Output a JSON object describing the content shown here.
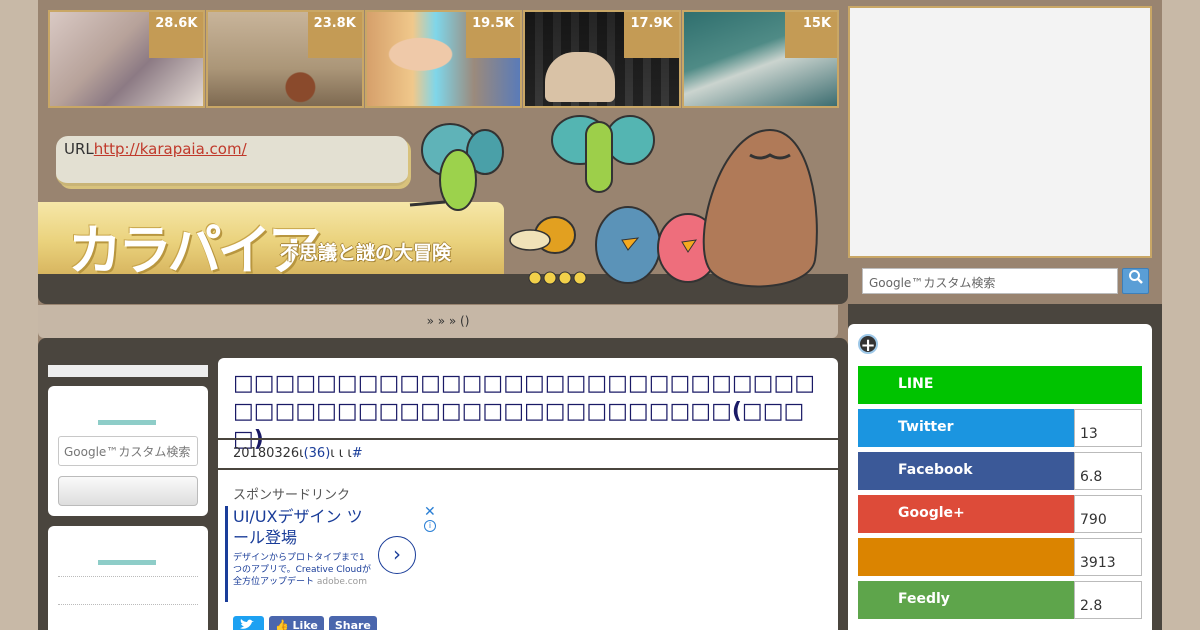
{
  "trending": [
    {
      "count": "28.6K"
    },
    {
      "count": "23.8K"
    },
    {
      "count": "19.5K"
    },
    {
      "count": "17.9K"
    },
    {
      "count": "15K"
    }
  ],
  "header": {
    "url_prefix": "URL",
    "url": "http://karapaia.com/",
    "logo": "カラパイア",
    "tagline": "不思議と謎の大冒険"
  },
  "breadcrumb": "»  »     » ()",
  "sidebar_left": {
    "search_placeholder": "Google™カスタム検索"
  },
  "article": {
    "title": "□□□□□□□□□□□□□□□□□□□□□□□□□□□□□□□□□□□□□□□□□□□□□□□□□□□□(□□□□)",
    "date": "20180326",
    "sep1": "ι",
    "comment_count": "(36)",
    "sep2": "ι ι     ι",
    "hash": "#",
    "sponsor": "スポンサードリンク"
  },
  "ad": {
    "headline": "UI/UXデザイン ツール登場",
    "body": "デザインからプロトタイプまで1つのアプリで。Creative Cloudが全方位アップデート",
    "domain": "adobe.com",
    "arrow": "›",
    "close": "✕",
    "info": "i"
  },
  "article_share": [
    {
      "label": ""
    },
    {
      "label": "Like"
    },
    {
      "label": "Share"
    }
  ],
  "right": {
    "search_placeholder": "Google™カスタム検索",
    "search_icon": "magnifier-icon",
    "plus": "+"
  },
  "share_counts": [
    {
      "name": "LINE",
      "count": "",
      "color": "#00c300"
    },
    {
      "name": "Twitter",
      "count": "13",
      "color": "#1b95e0"
    },
    {
      "name": "Facebook",
      "count": "6.8",
      "color": "#3b5998"
    },
    {
      "name": "Google+",
      "count": "790",
      "color": "#dd4b39"
    },
    {
      "name": "",
      "count": "3913",
      "color": "#db8400"
    },
    {
      "name": "Feedly",
      "count": "2.8",
      "color": "#5ea54b"
    }
  ]
}
